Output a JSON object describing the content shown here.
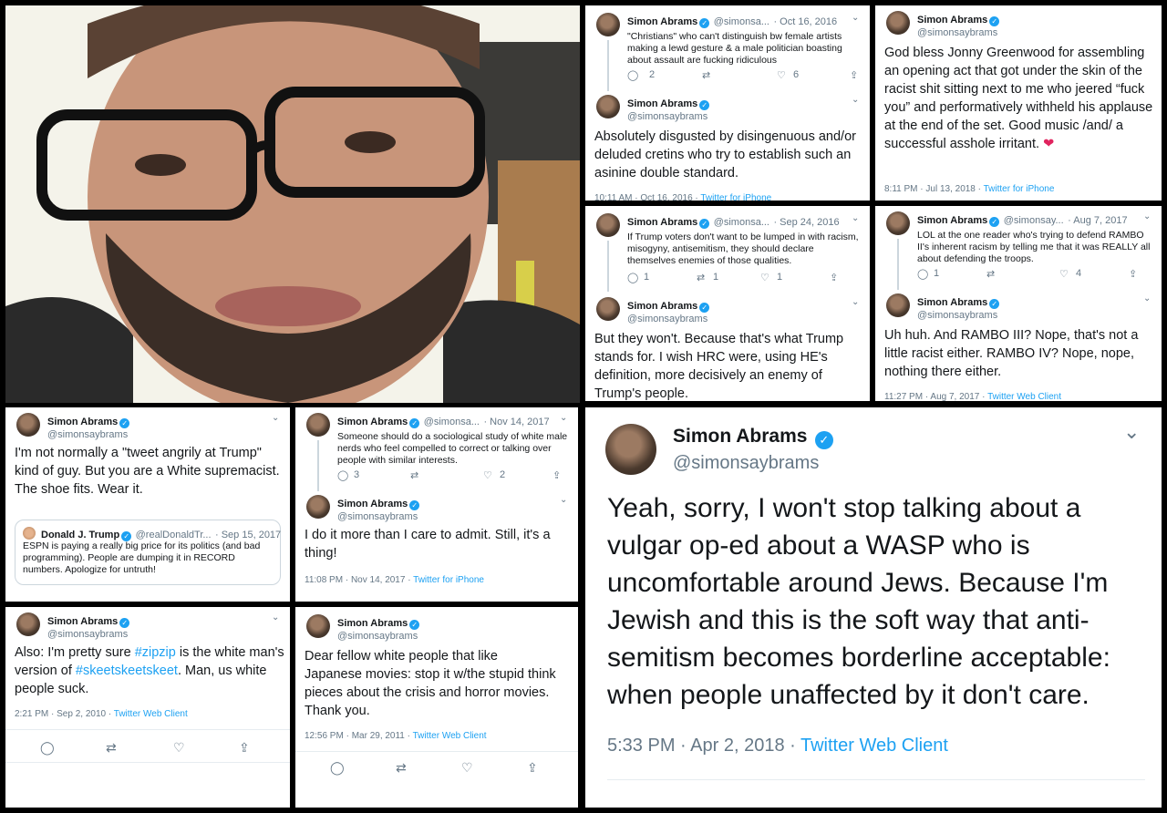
{
  "photo": {
    "description_icon": "person-photo"
  },
  "accent_color": "#1da1f2",
  "panels": {
    "p1": {
      "t1": {
        "name": "Simon Abrams",
        "handle": "@simonsa...",
        "date": "· Oct 16, 2016",
        "text": "\"Christians\" who can't distinguish bw female artists making a lewd gesture & a male politician boasting about assault are fucking ridiculous",
        "replies": "2",
        "likes": "6"
      },
      "t2": {
        "name": "Simon Abrams",
        "handle": "@simonsaybrams",
        "text": "Absolutely disgusted by disingenuous and/or deluded cretins who try to establish such an asinine double standard.",
        "time": "10:11 AM · Oct 16, 2016 ·",
        "source": "Twitter for iPhone"
      }
    },
    "p2": {
      "name": "Simon Abrams",
      "handle": "@simonsaybrams",
      "text": "God bless Jonny Greenwood for assembling an opening act that got under the skin of the racist shit sitting next to me who jeered “fuck you” and performatively withheld his applause at the end of the set. Good music /and/ a successful asshole irritant.",
      "heart": "❤",
      "time": "8:11 PM · Jul 13, 2018 ·",
      "source": "Twitter for iPhone"
    },
    "p3": {
      "t1": {
        "name": "Simon Abrams",
        "handle": "@simonsa...",
        "date": "· Sep 24, 2016",
        "text": "If Trump voters don't want to be lumped in with racism, misogyny, antisemitism, they should declare themselves enemies of those qualities.",
        "replies": "1",
        "retweets": "1",
        "likes": "1"
      },
      "t2": {
        "name": "Simon Abrams",
        "handle": "@simonsaybrams",
        "text": "But they won't. Because that's what Trump stands for. I wish HRC were, using HE's definition, more decisively an enemy of Trump's people."
      }
    },
    "p4": {
      "t1": {
        "name": "Simon Abrams",
        "handle": "@simonsay...",
        "date": "· Aug 7, 2017",
        "text": "LOL at the one reader who's trying to defend RAMBO II's inherent racism by telling me that it was REALLY all about defending the troops.",
        "replies": "1",
        "likes": "4"
      },
      "t2": {
        "name": "Simon Abrams",
        "handle": "@simonsaybrams",
        "text": "Uh huh. And RAMBO III? Nope, that's not a little racist either. RAMBO IV? Nope, nope, nothing there either.",
        "time": "11:27 PM · Aug 7, 2017 ·",
        "source": "Twitter Web Client"
      }
    },
    "p5": {
      "name": "Simon Abrams",
      "handle": "@simonsaybrams",
      "text": "I'm not normally a \"tweet angrily at Trump\" kind of guy. But you are a White supremacist. The shoe fits. Wear it.",
      "quote": {
        "name": "Donald J. Trump",
        "handle": "@realDonaldTr...",
        "date": "· Sep 15, 2017",
        "text": "ESPN is paying a really big price for its politics (and bad programming). People are dumping it in RECORD numbers. Apologize for untruth!"
      }
    },
    "p6": {
      "t1": {
        "name": "Simon Abrams",
        "handle": "@simonsa...",
        "date": "· Nov 14, 2017",
        "text": "Someone should do a sociological study of white male nerds who feel compelled to correct or talking over people with similar interests.",
        "replies": "3",
        "likes": "2"
      },
      "t2": {
        "name": "Simon Abrams",
        "handle": "@simonsaybrams",
        "text": "I do it more than I care to admit. Still, it's a thing!",
        "time": "11:08 PM · Nov 14, 2017 ·",
        "source": "Twitter for iPhone"
      }
    },
    "p7": {
      "name": "Simon Abrams",
      "handle": "@simonsaybrams",
      "text_pre": "Also: I'm pretty sure ",
      "tag1": "#zipzip",
      "text_mid": " is the white man's version of ",
      "tag2": "#skeetskeetskeet",
      "text_post": ". Man, us white people suck.",
      "time": "2:21 PM · Sep 2, 2010 ·",
      "source": "Twitter Web Client"
    },
    "p8": {
      "name": "Simon Abrams",
      "handle": "@simonsaybrams",
      "text": "Dear fellow white people that like Japanese movies: stop it w/the stupid think pieces about the crisis and horror movies. Thank you.",
      "time": "12:56 PM · Mar 29, 2011 ·",
      "source": "Twitter Web Client"
    },
    "p9": {
      "name": "Simon Abrams",
      "handle": "@simonsaybrams",
      "text": "Yeah, sorry, I won't stop talking about a vulgar op-ed about a WASP who is uncomfortable around Jews. Because I'm Jewish and this is the soft way that anti-semitism becomes borderline acceptable: when people unaffected by it don't care.",
      "time": "5:33 PM · Apr 2, 2018 ·",
      "source": "Twitter Web Client"
    }
  }
}
